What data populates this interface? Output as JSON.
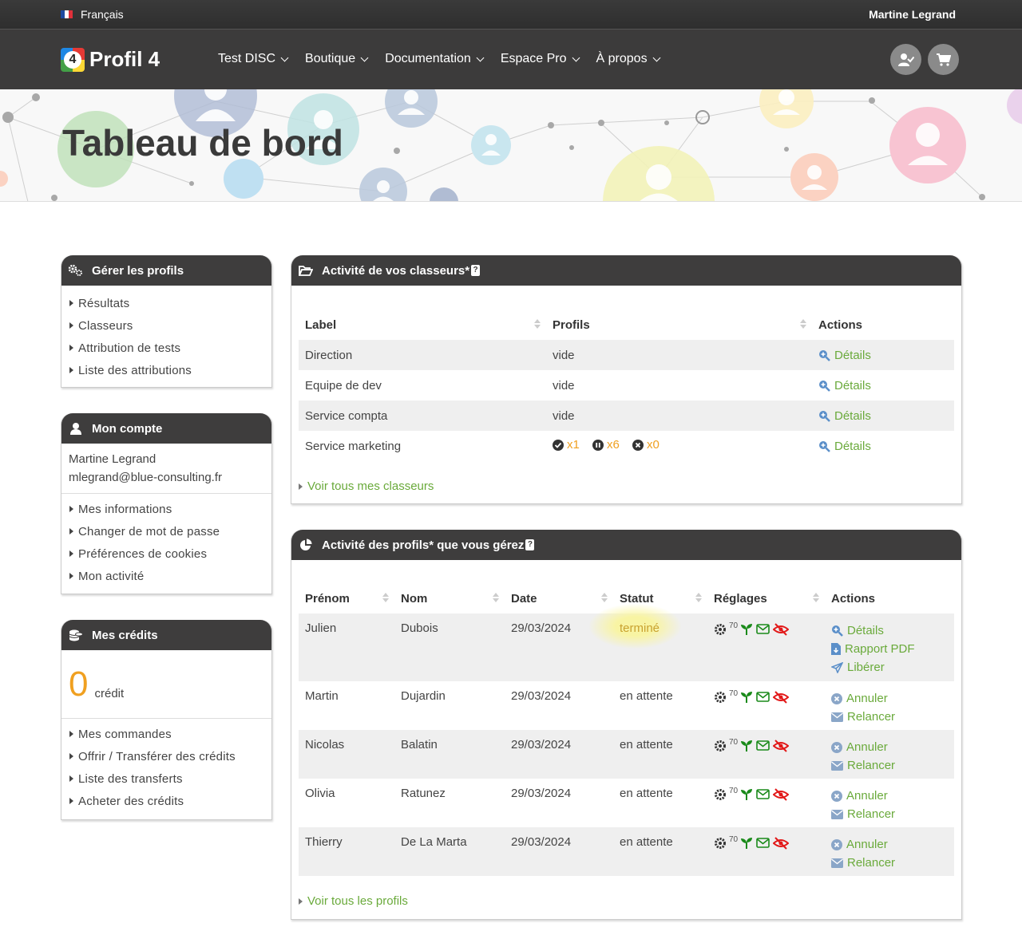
{
  "topbar": {
    "language": "Français",
    "user": "Martine Legrand"
  },
  "brand": {
    "name": "Profil 4",
    "logo_digit": "4"
  },
  "nav": {
    "items": [
      "Test DISC",
      "Boutique",
      "Documentation",
      "Espace Pro",
      "À propos"
    ],
    "account_icon": "user-check-icon",
    "cart_icon": "cart-icon"
  },
  "page": {
    "title": "Tableau de bord"
  },
  "sidebar": {
    "manage": {
      "title": "Gérer les profils",
      "links": [
        "Résultats",
        "Classeurs",
        "Attribution de tests",
        "Liste des attributions"
      ]
    },
    "account": {
      "title": "Mon compte",
      "name": "Martine Legrand",
      "email": "mlegrand@blue-consulting.fr",
      "links": [
        "Mes informations",
        "Changer de mot de passe",
        "Préférences de cookies",
        "Mon activité"
      ]
    },
    "credits": {
      "title": "Mes crédits",
      "amount": "0",
      "unit": "crédit",
      "links": [
        "Mes commandes",
        "Offrir / Transférer des crédits",
        "Liste des transferts",
        "Acheter des crédits"
      ]
    }
  },
  "binders": {
    "title": "Activité de vos classeurs*",
    "columns": [
      "Label",
      "Profils",
      "Actions"
    ],
    "rows": [
      {
        "label": "Direction",
        "profiles": "vide",
        "action": "Détails"
      },
      {
        "label": "Equipe de dev",
        "profiles": "vide",
        "action": "Détails"
      },
      {
        "label": "Service compta",
        "profiles": "vide",
        "action": "Détails"
      },
      {
        "label": "Service marketing",
        "profiles": "",
        "counts": [
          "x1",
          "x6",
          "x0"
        ],
        "action": "Détails"
      }
    ],
    "see_all": "Voir tous mes classeurs"
  },
  "profiles": {
    "title": "Activité des profils* que vous gérez",
    "columns": [
      "Prénom",
      "Nom",
      "Date",
      "Statut",
      "Réglages",
      "Actions"
    ],
    "settings_value": "70",
    "rows": [
      {
        "first": "Julien",
        "last": "Dubois",
        "date": "29/03/2024",
        "status": "terminé",
        "actions": [
          "Détails",
          "Rapport PDF",
          "Libérer"
        ]
      },
      {
        "first": "Martin",
        "last": "Dujardin",
        "date": "29/03/2024",
        "status": "en attente",
        "actions": [
          "Annuler",
          "Relancer"
        ]
      },
      {
        "first": "Nicolas",
        "last": "Balatin",
        "date": "29/03/2024",
        "status": "en attente",
        "actions": [
          "Annuler",
          "Relancer"
        ]
      },
      {
        "first": "Olivia",
        "last": "Ratunez",
        "date": "29/03/2024",
        "status": "en attente",
        "actions": [
          "Annuler",
          "Relancer"
        ]
      },
      {
        "first": "Thierry",
        "last": "De La Marta",
        "date": "29/03/2024",
        "status": "en attente",
        "actions": [
          "Annuler",
          "Relancer"
        ]
      }
    ],
    "see_all": "Voir tous les profils"
  },
  "colors": {
    "accent_green": "#6aaa3b",
    "dark_header": "#3e3d3d",
    "orange": "#f0a020",
    "red": "#e21818"
  }
}
